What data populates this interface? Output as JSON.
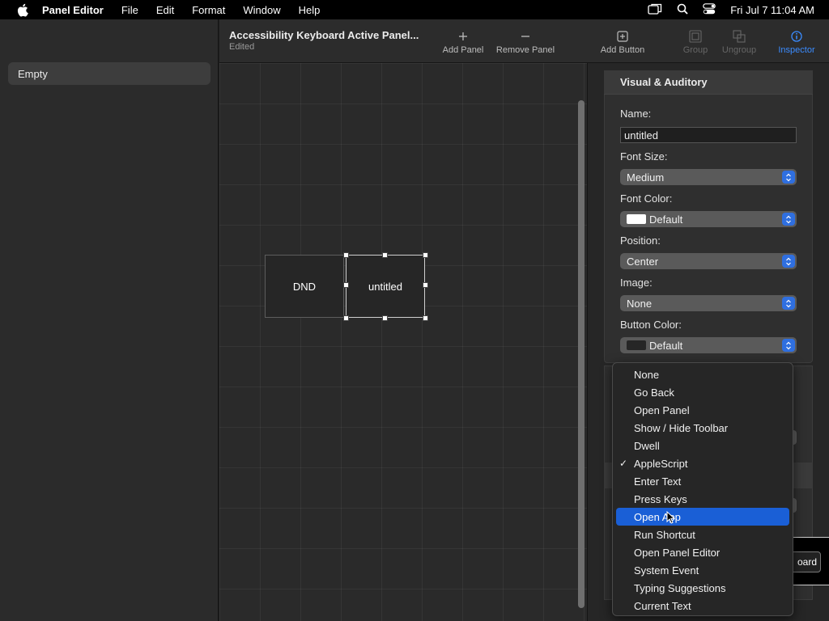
{
  "menubar": {
    "app_name": "Panel Editor",
    "menus": [
      "File",
      "Edit",
      "Format",
      "Window",
      "Help"
    ],
    "clock": "Fri Jul 7  11:04 AM"
  },
  "sidebar": {
    "items": [
      {
        "label": "Empty"
      }
    ]
  },
  "toolbar": {
    "title": "Accessibility Keyboard Active Panel...",
    "subtitle": "Edited",
    "buttons": [
      {
        "label": "Add Panel",
        "icon": "plus-icon"
      },
      {
        "label": "Remove Panel",
        "icon": "minus-icon"
      },
      {
        "label": "Add Button",
        "icon": "add-button-icon"
      },
      {
        "label": "Group",
        "icon": "group-icon"
      },
      {
        "label": "Ungroup",
        "icon": "ungroup-icon"
      },
      {
        "label": "Inspector",
        "icon": "info-icon"
      }
    ]
  },
  "canvas": {
    "buttons": [
      {
        "label": "DND"
      },
      {
        "label": "untitled"
      }
    ]
  },
  "inspector": {
    "section_title": "Visual & Auditory",
    "name_label": "Name:",
    "name_value": "untitled",
    "font_size_label": "Font Size:",
    "font_size_value": "Medium",
    "font_color_label": "Font Color:",
    "font_color_value": "Default",
    "font_color_swatch": "#ffffff",
    "position_label": "Position:",
    "position_value": "Center",
    "image_label": "Image:",
    "image_value": "None",
    "button_color_label": "Button Color:",
    "button_color_value": "Default",
    "button_color_swatch": "#262626",
    "peek_text": "oard"
  },
  "dropdown": {
    "items": [
      {
        "label": "None",
        "checked": false,
        "selected": false
      },
      {
        "label": "Go Back",
        "checked": false,
        "selected": false
      },
      {
        "label": "Open Panel",
        "checked": false,
        "selected": false
      },
      {
        "label": "Show / Hide Toolbar",
        "checked": false,
        "selected": false
      },
      {
        "label": "Dwell",
        "checked": false,
        "selected": false
      },
      {
        "label": "AppleScript",
        "checked": true,
        "selected": false
      },
      {
        "label": "Enter Text",
        "checked": false,
        "selected": false
      },
      {
        "label": "Press Keys",
        "checked": false,
        "selected": false
      },
      {
        "label": "Open App",
        "checked": false,
        "selected": true
      },
      {
        "label": "Run Shortcut",
        "checked": false,
        "selected": false
      },
      {
        "label": "Open Panel Editor",
        "checked": false,
        "selected": false
      },
      {
        "label": "System Event",
        "checked": false,
        "selected": false
      },
      {
        "label": "Typing Suggestions",
        "checked": false,
        "selected": false
      },
      {
        "label": "Current Text",
        "checked": false,
        "selected": false
      }
    ],
    "check_mark": "✓"
  },
  "colors": {
    "accent": "#1a5fd6",
    "inspector_active": "#3b8cff"
  }
}
